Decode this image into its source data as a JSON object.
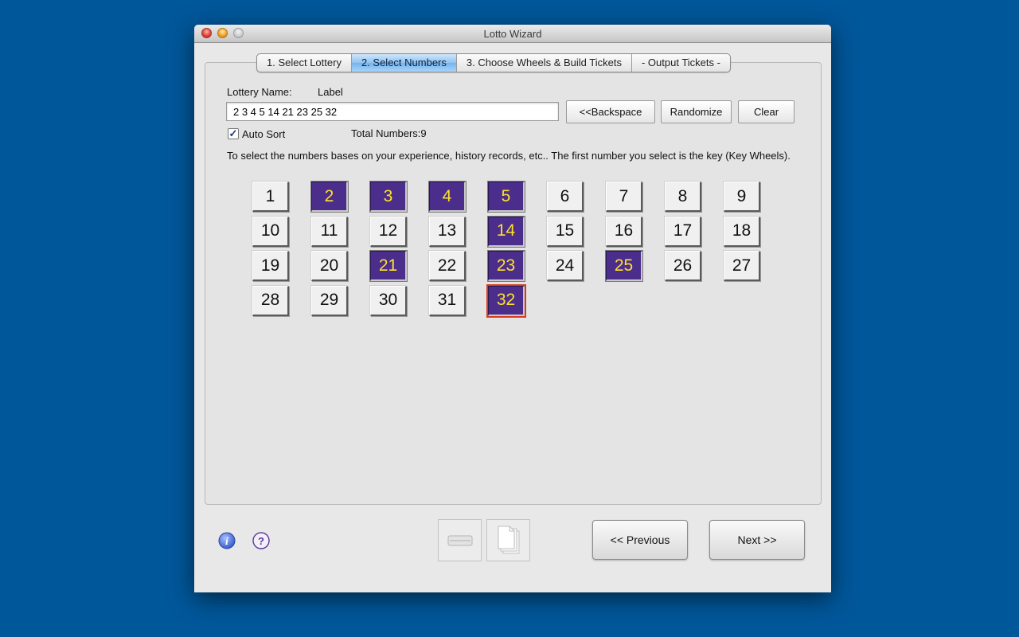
{
  "window": {
    "title": "Lotto Wizard"
  },
  "tabs": [
    {
      "label": "1. Select Lottery",
      "active": false
    },
    {
      "label": "2. Select Numbers",
      "active": true
    },
    {
      "label": "3. Choose Wheels & Build Tickets",
      "active": false
    },
    {
      "label": "- Output Tickets -",
      "active": false
    }
  ],
  "form": {
    "lottery_name_label": "Lottery Name:",
    "lottery_name_value": "Label",
    "numbers_value": "2 3 4 5 14 21 23 25 32",
    "backspace_label": "<<Backspace",
    "randomize_label": "Randomize",
    "clear_label": "Clear",
    "auto_sort_label": "Auto Sort",
    "auto_sort_checked": true,
    "total_numbers_label": "Total Numbers:9",
    "description": "To select the numbers bases on your experience, history records, etc.. The first number you select is the key (Key Wheels)."
  },
  "numbers": {
    "all": [
      1,
      2,
      3,
      4,
      5,
      6,
      7,
      8,
      9,
      10,
      11,
      12,
      13,
      14,
      15,
      16,
      17,
      18,
      19,
      20,
      21,
      22,
      23,
      24,
      25,
      26,
      27,
      28,
      29,
      30,
      31,
      32
    ],
    "selected": [
      2,
      3,
      4,
      5,
      14,
      21,
      23,
      25,
      32
    ],
    "last_selected": 32
  },
  "colors": {
    "desktop": "#00579a",
    "selected_bg": "#4b2e8c",
    "selected_text": "#ffe02a",
    "last_border": "#d93a1a"
  },
  "footer": {
    "info_icon": "info-icon",
    "help_icon": "help-icon",
    "previous_label": "<< Previous",
    "next_label": "Next >>"
  }
}
